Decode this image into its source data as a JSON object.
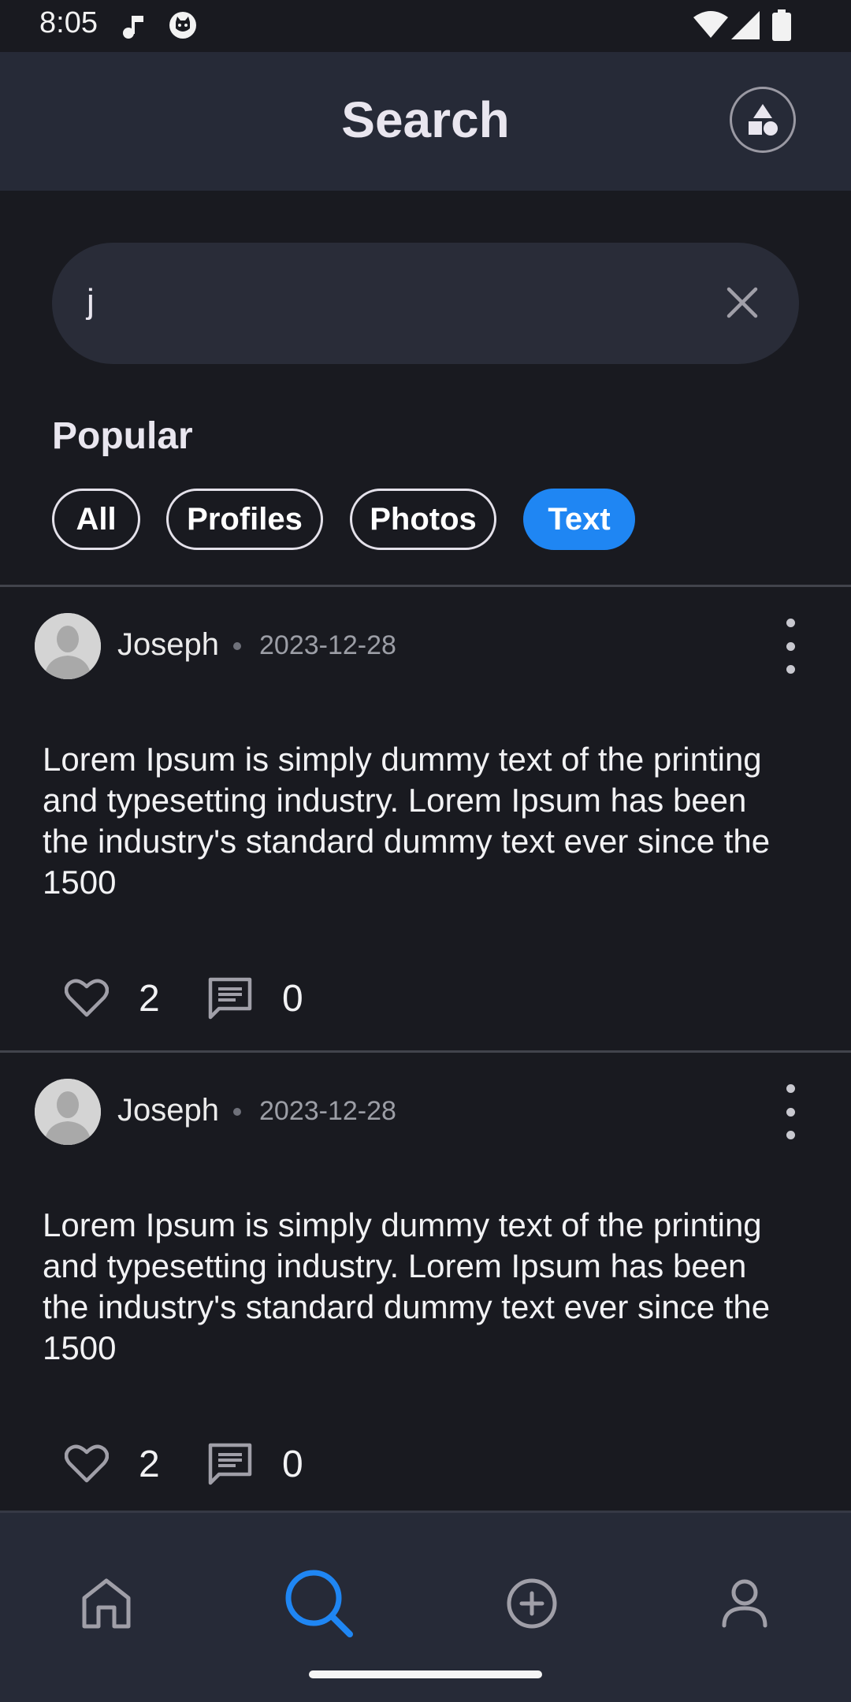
{
  "status_bar": {
    "time": "8:05"
  },
  "header": {
    "title": "Search",
    "action_icon": "shapes-icon"
  },
  "search": {
    "value": "j",
    "clear_icon": "close-icon"
  },
  "section": {
    "title": "Popular"
  },
  "filters": [
    {
      "label": "All",
      "active": false
    },
    {
      "label": "Profiles",
      "active": false
    },
    {
      "label": "Photos",
      "active": false
    },
    {
      "label": "Text",
      "active": true
    }
  ],
  "posts": [
    {
      "author": "Joseph",
      "date": "2023-12-28",
      "text": "Lorem Ipsum is simply dummy text of the printing and typesetting industry. Lorem Ipsum has been the industry's standard dummy text ever since the 1500",
      "likes": "2",
      "comments": "0"
    },
    {
      "author": "Joseph",
      "date": "2023-12-28",
      "text": "Lorem Ipsum is simply dummy text of the printing and typesetting industry. Lorem Ipsum has been the industry's standard dummy text ever since the 1500",
      "likes": "2",
      "comments": "0"
    }
  ],
  "bottom_nav": {
    "items": [
      {
        "icon": "home-icon",
        "active": false
      },
      {
        "icon": "search-icon",
        "active": true
      },
      {
        "icon": "add-circle-icon",
        "active": false
      },
      {
        "icon": "profile-icon",
        "active": false
      }
    ]
  },
  "colors": {
    "accent": "#1f86f3",
    "background": "#191a20",
    "surface": "#262a37",
    "search_field": "#292c38"
  }
}
